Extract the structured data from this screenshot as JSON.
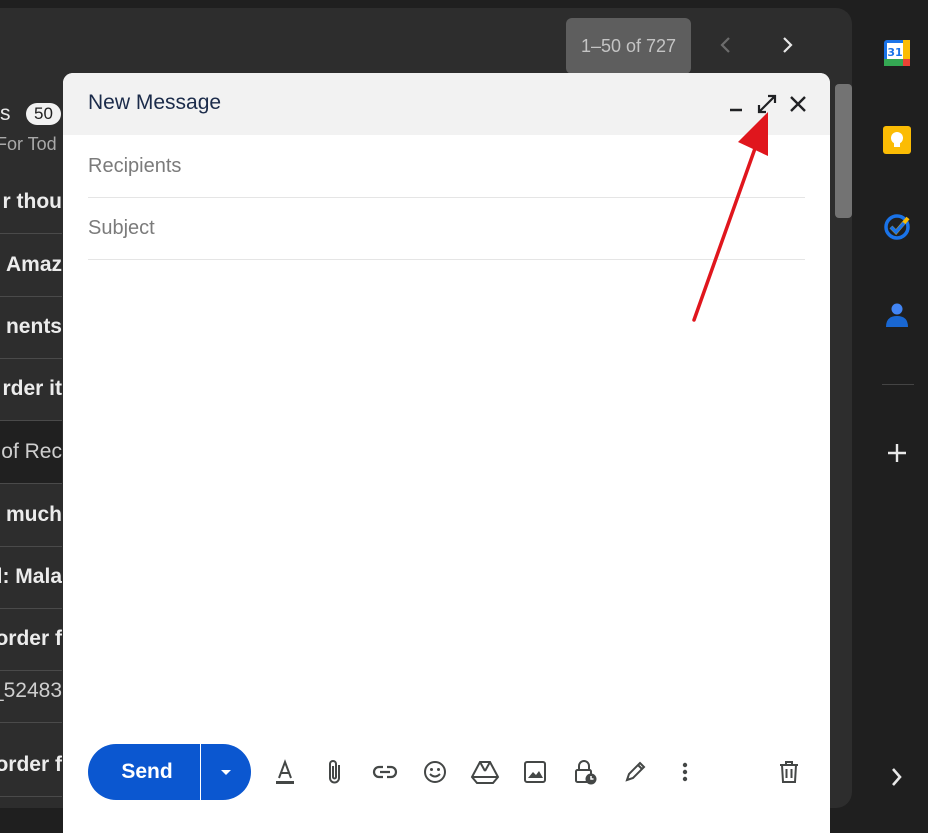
{
  "mail_list": {
    "pagination": "1–50 of 727",
    "inbox_label": "s",
    "inbox_count": "50",
    "for_today": "For Tod",
    "rows": [
      {
        "text": "r thou",
        "bold": true
      },
      {
        "text": "n Amaz",
        "bold": true
      },
      {
        "text": "nents",
        "bold": true
      },
      {
        "text": "rder it",
        "bold": true
      },
      {
        "text": "of Rec",
        "bold": false
      },
      {
        "text": "much",
        "bold": true
      },
      {
        "text": "d: Mala",
        "bold": true
      },
      {
        "text": "order f",
        "bold": true
      },
      {
        "text": "_52483",
        "bold": false
      },
      {
        "text": "order f",
        "bold": true
      }
    ]
  },
  "side_panel": {
    "calendar_date": "31"
  },
  "compose": {
    "title": "New Message",
    "recipients_placeholder": "Recipients",
    "subject_placeholder": "Subject",
    "send_label": "Send"
  },
  "colors": {
    "accent": "#0b57d0",
    "annotation_arrow": "#e0161d"
  }
}
